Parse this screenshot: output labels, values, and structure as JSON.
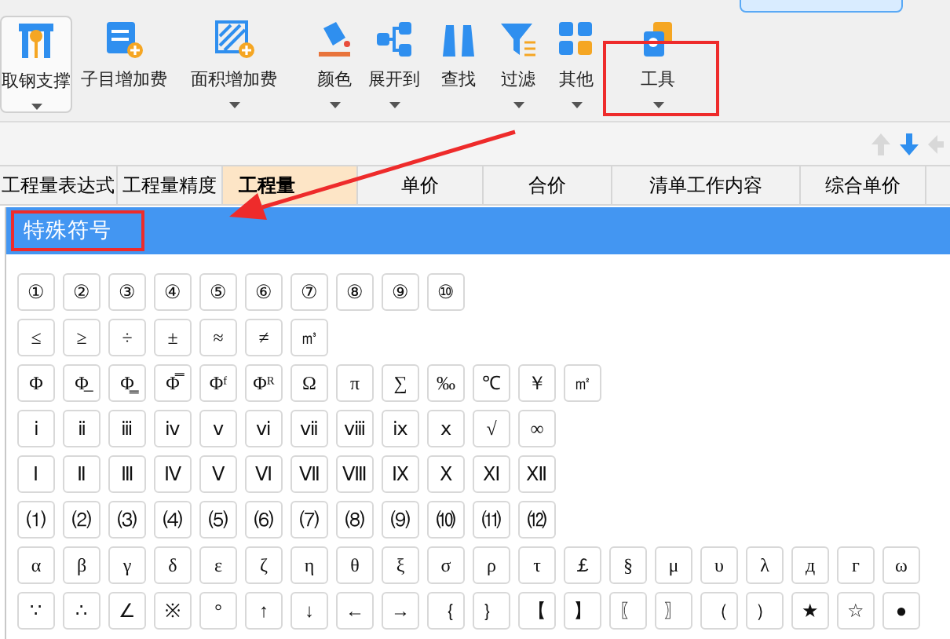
{
  "toolbar": {
    "buttons": [
      {
        "label": "取钢支撑",
        "dropdown": true,
        "selected": true
      },
      {
        "label": "子目增加费",
        "dropdown": false,
        "selected": false
      },
      {
        "label": "面积增加费",
        "dropdown": true,
        "selected": false
      },
      {
        "label": "颜色",
        "dropdown": true,
        "selected": false
      },
      {
        "label": "展开到",
        "dropdown": true,
        "selected": false
      },
      {
        "label": "查找",
        "dropdown": false,
        "selected": false
      },
      {
        "label": "过滤",
        "dropdown": true,
        "selected": false
      },
      {
        "label": "其他",
        "dropdown": true,
        "selected": false
      },
      {
        "label": "工具",
        "dropdown": true,
        "selected": false
      }
    ]
  },
  "table": {
    "columns": [
      {
        "label": "工程量表达式",
        "selected": false
      },
      {
        "label": "工程量精度",
        "selected": false
      },
      {
        "label": "工程量",
        "selected": true
      },
      {
        "label": "单价",
        "selected": false
      },
      {
        "label": "合价",
        "selected": false
      },
      {
        "label": "清单工作内容",
        "selected": false
      },
      {
        "label": "综合单价",
        "selected": false
      }
    ]
  },
  "dialog": {
    "title": "特殊符号",
    "symbol_rows": [
      [
        "①",
        "②",
        "③",
        "④",
        "⑤",
        "⑥",
        "⑦",
        "⑧",
        "⑨",
        "⑩"
      ],
      [
        "≤",
        "≥",
        "÷",
        "±",
        "≈",
        "≠",
        "㎥"
      ],
      [
        "Φ",
        "Φ̲",
        "Φ̳",
        "Φ̿",
        "Φᶠ",
        "Φᴿ",
        "Ω",
        "π",
        "∑",
        "‰",
        "℃",
        "￥",
        "㎡"
      ],
      [
        "ⅰ",
        "ⅱ",
        "ⅲ",
        "ⅳ",
        "ⅴ",
        "ⅵ",
        "ⅶ",
        "ⅷ",
        "ⅸ",
        "ⅹ",
        "√",
        "∞"
      ],
      [
        "Ⅰ",
        "Ⅱ",
        "Ⅲ",
        "Ⅳ",
        "Ⅴ",
        "Ⅵ",
        "Ⅶ",
        "Ⅷ",
        "Ⅸ",
        "Ⅹ",
        "Ⅺ",
        "Ⅻ"
      ],
      [
        "⑴",
        "⑵",
        "⑶",
        "⑷",
        "⑸",
        "⑹",
        "⑺",
        "⑻",
        "⑼",
        "⑽",
        "⑾",
        "⑿"
      ],
      [
        "α",
        "β",
        "γ",
        "δ",
        "ε",
        "ζ",
        "η",
        "θ",
        "ξ",
        "σ",
        "ρ",
        "τ",
        "￡",
        "§",
        "μ",
        "υ",
        "λ",
        "д",
        "г",
        "ω"
      ],
      [
        "∵",
        "∴",
        "∠",
        "※",
        "°",
        "↑",
        "↓",
        "←",
        "→",
        "｛",
        "｝",
        "【",
        "】",
        "〖",
        "〗",
        "（",
        "）",
        "★",
        "☆",
        "●"
      ]
    ]
  }
}
